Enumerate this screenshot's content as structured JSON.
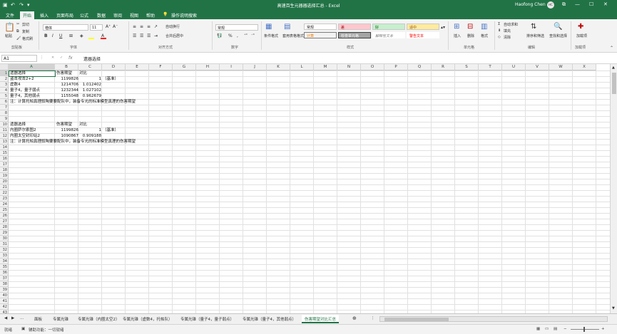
{
  "window": {
    "title": "高速百生元器器选择汇总 - Excel",
    "user": "Haofong Chen",
    "avatar": "HC",
    "min": "—",
    "max": "☐",
    "close": "✕",
    "ribbon_opts": "⧉"
  },
  "tabs": [
    "文件",
    "开始",
    "插入",
    "页面布局",
    "公式",
    "数据",
    "审阅",
    "视图",
    "帮助"
  ],
  "tell_me": "操作说明搜索",
  "ribbon": {
    "paste": "粘贴",
    "cut": "剪切",
    "copy": "复制",
    "format_painter": "格式刷",
    "clipboard": "剪贴板",
    "font_name": "楷体",
    "font_size": "11",
    "font_group": "字体",
    "wrap": "自动换行",
    "merge": "合并后居中",
    "align_group": "对齐方式",
    "num_format": "常规",
    "num_group": "数字",
    "cond_format": "条件格式",
    "table_format": "套用表格格式",
    "styles": [
      "常规",
      "差",
      "好",
      "适中",
      "计算",
      "检查单元格",
      "解释性文本",
      "警告文本"
    ],
    "styles_group": "样式",
    "insert": "插入",
    "delete": "删除",
    "format": "格式",
    "cells_group": "单元格",
    "autosum": "自动求和",
    "fill": "填充",
    "clear": "清除",
    "sort": "排序和筛选",
    "find": "查找和选择",
    "edit_group": "编辑",
    "addins": "加载项",
    "addins_group": "加载项"
  },
  "formula_bar": {
    "name_box": "A1",
    "fx": "fx",
    "content": "遗器选择"
  },
  "columns": [
    "A",
    "B",
    "C",
    "D",
    "E",
    "F",
    "G",
    "H",
    "I",
    "J",
    "K",
    "L",
    "M",
    "N",
    "O",
    "P",
    "Q",
    "R",
    "S",
    "T",
    "U",
    "V",
    "W",
    "X"
  ],
  "rows": {
    "r1": {
      "a": "遗器选择",
      "b": "伤害期望",
      "c": "对比"
    },
    "r2": {
      "a": "盗击攻击2+2",
      "b": "1199826",
      "c": "1",
      "d": "（基准）"
    },
    "r3": {
      "a": "虚数4",
      "b": "1214706",
      "c": "1.012402"
    },
    "r4": {
      "a": "量子4，量子弱点",
      "b": "1232344",
      "c": "1.027102"
    },
    "r5": {
      "a": "量子4，其他弱点",
      "b": "1155048",
      "c": "0.962679"
    },
    "r6": {
      "a": "注：计算托帕真理叙陶要要配队中，装备专光的标准模型真理的伤害期望"
    },
    "r9": {
      "a": "遗器选择",
      "b": "伤害期望",
      "c": "对比"
    },
    "r10": {
      "a": "内圈萨尔索图2",
      "b": "1199826",
      "c": "1",
      "d": "（基准）"
    },
    "r11": {
      "a": "内圈太空封印站2",
      "b": "1090867",
      "c": "0.909188"
    },
    "r12": {
      "a": "注：计算托帕真理叙陶要要配队中，装备专光的标准模型真理的伤害期望"
    }
  },
  "sheet_tabs": [
    "面板",
    "专属光锥",
    "专属光锥（内圈太空2）",
    "专属光锥（虚数4，托帕队）",
    "专属光锥（量子4，量子弱点）",
    "专属光锥（量子4，其他弱点）",
    "伤害期望对比汇总"
  ],
  "status": {
    "ready": "就绪",
    "accessibility": "辅助功能：一切就绪"
  }
}
